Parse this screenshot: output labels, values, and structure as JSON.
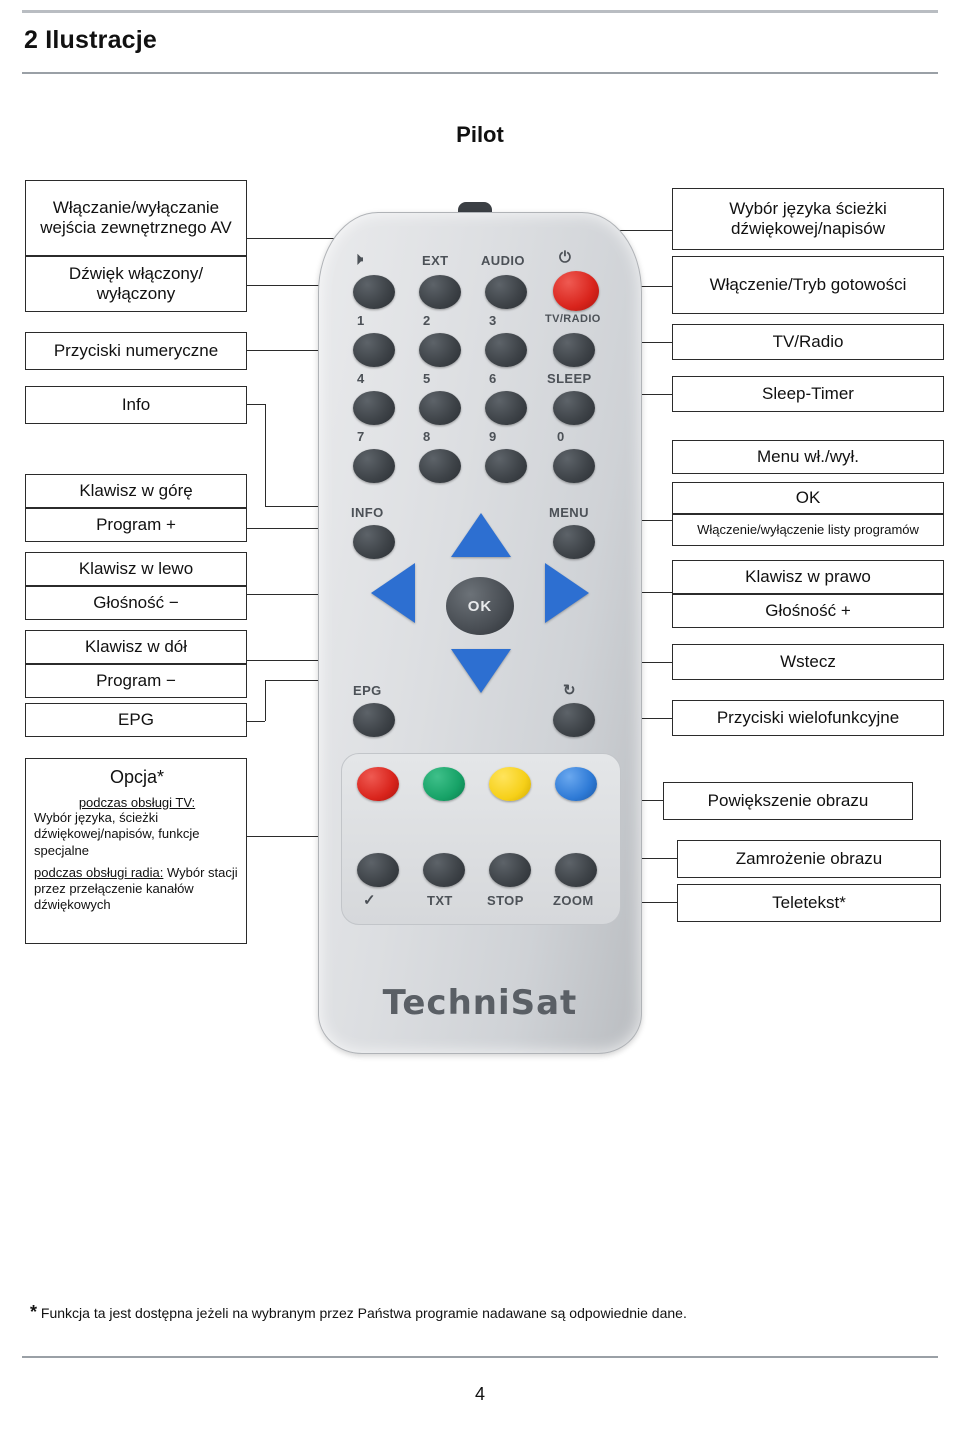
{
  "header": {
    "chapter_number": "2",
    "chapter_title": "Ilustracje",
    "title_full": "2 Ilustracje"
  },
  "figure": {
    "title": "Pilot"
  },
  "left_labels": [
    {
      "id": "av-toggle",
      "text": "Włączanie/wyłączanie wejścia zewnętrznego AV"
    },
    {
      "id": "mute",
      "text": "Dźwięk włączony/ wyłączony"
    },
    {
      "id": "numeric-keys",
      "text": "Przyciski numeryczne"
    },
    {
      "id": "info",
      "text": "Info"
    },
    {
      "id": "key-up",
      "text": "Klawisz w górę"
    },
    {
      "id": "program-plus",
      "text": "Program +"
    },
    {
      "id": "key-left",
      "text": "Klawisz w lewo"
    },
    {
      "id": "volume-minus",
      "text": "Głośność −"
    },
    {
      "id": "key-down",
      "text": "Klawisz w dół"
    },
    {
      "id": "program-minus",
      "text": "Program −"
    },
    {
      "id": "epg",
      "text": "EPG"
    }
  ],
  "option_label": {
    "title": "Opcja*",
    "tv_heading": "podczas obsługi TV:",
    "tv_text": "Wybór języka, ścieżki dźwiękowej/napisów, funkcje specjalne",
    "radio_heading": "podczas obsługi radia:",
    "radio_text": "Wybór stacji przez przełączenie kanałów dźwiękowych"
  },
  "right_labels": [
    {
      "id": "audio-language",
      "text": "Wybór języka ścieżki dźwiękowej/napisów"
    },
    {
      "id": "standby",
      "text": "Włączenie/Tryb gotowości"
    },
    {
      "id": "tv-radio",
      "text": "TV/Radio"
    },
    {
      "id": "sleep-timer",
      "text": "Sleep-Timer"
    },
    {
      "id": "menu",
      "text": "Menu wł./wył."
    },
    {
      "id": "ok",
      "text": "OK"
    },
    {
      "id": "program-list",
      "text": "Włączenie/wyłączenie listy programów"
    },
    {
      "id": "key-right",
      "text": "Klawisz w prawo"
    },
    {
      "id": "volume-plus",
      "text": "Głośność +"
    },
    {
      "id": "back",
      "text": "Wstecz"
    },
    {
      "id": "multifunction",
      "text": "Przyciski wielofunkcyjne"
    },
    {
      "id": "zoom",
      "text": "Powiększenie obrazu"
    },
    {
      "id": "freeze",
      "text": "Zamrożenie obrazu"
    },
    {
      "id": "teletext",
      "text": "Teletekst*"
    }
  ],
  "remote": {
    "brand": "TechniSat",
    "key_labels": {
      "ext": "EXT",
      "audio": "AUDIO",
      "tvradio": "TV/RADIO",
      "sleep": "SLEEP",
      "info": "INFO",
      "menu": "MENU",
      "epg": "EPG",
      "ok": "OK",
      "txt": "TXT",
      "stop": "STOP",
      "zoom": "ZOOM",
      "num1": "1",
      "num2": "2",
      "num3": "3",
      "num4": "4",
      "num5": "5",
      "num6": "6",
      "num7": "7",
      "num8": "8",
      "num9": "9",
      "num0": "0"
    }
  },
  "footnote": {
    "marker": "*",
    "text": "Funkcja ta jest dostępna jeżeli na wybranym przez Państwa programie nadawane są odpowiednie dane."
  },
  "page_number": "4"
}
